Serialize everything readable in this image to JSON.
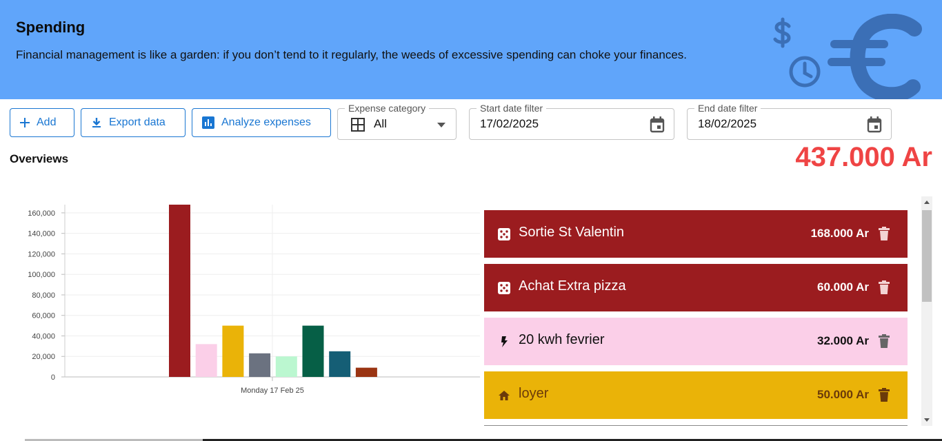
{
  "header": {
    "title": "Spending",
    "subtitle": "Financial management is like a garden: if you don’t tend to it regularly, the weeds of excessive spending can choke your finances.",
    "art_icons": [
      "dollar-icon",
      "clock-icon",
      "euro-icon"
    ]
  },
  "toolbar": {
    "add_label": "Add",
    "export_label": "Export data",
    "analyze_label": "Analyze expenses"
  },
  "filters": {
    "category": {
      "label": "Expense category",
      "value": "All"
    },
    "start_date": {
      "label": "Start date filter",
      "value": "17/02/2025"
    },
    "end_date": {
      "label": "End date filter",
      "value": "18/02/2025"
    }
  },
  "overview": {
    "title": "Overviews",
    "total": "437.000 Ar"
  },
  "chart_data": {
    "type": "bar",
    "categories": [
      "Monday 17 Feb 25"
    ],
    "series": [
      {
        "values": [
          168000
        ],
        "color": "#9b1c1f"
      },
      {
        "values": [
          32000
        ],
        "color": "#fbcfe8"
      },
      {
        "values": [
          50000
        ],
        "color": "#eab308"
      },
      {
        "values": [
          23000
        ],
        "color": "#6b7280"
      },
      {
        "values": [
          20000
        ],
        "color": "#bbf7d0"
      },
      {
        "values": [
          50000
        ],
        "color": "#065f46"
      },
      {
        "values": [
          25000
        ],
        "color": "#155e75"
      },
      {
        "values": [
          9000
        ],
        "color": "#9a3412"
      }
    ],
    "yticks": [
      "0",
      "20,000",
      "40,000",
      "60,000",
      "80,000",
      "100,000",
      "120,000",
      "140,000",
      "160,000"
    ],
    "ylim": [
      0,
      168000
    ],
    "grid": true
  },
  "expenses": [
    {
      "title": "Sortie St Valentin",
      "amount": "168.000 Ar",
      "icon": "dice-icon",
      "bg": "#9b1c1f",
      "fg": "#ffffff",
      "icon_color": "#ffffff",
      "del_color": "#f3d3d3"
    },
    {
      "title": "Achat Extra pizza",
      "amount": "60.000 Ar",
      "icon": "dice-icon",
      "bg": "#9b1c1f",
      "fg": "#ffffff",
      "icon_color": "#ffffff",
      "del_color": "#f3d3d3"
    },
    {
      "title": "20 kwh fevrier",
      "amount": "32.000 Ar",
      "icon": "bolt-icon",
      "bg": "#fbcfe8",
      "fg": "#111111",
      "icon_color": "#111111",
      "del_color": "#666666"
    },
    {
      "title": "loyer",
      "amount": "50.000 Ar",
      "icon": "home-icon",
      "bg": "#eab308",
      "fg": "#6b3a0a",
      "icon_color": "#6b3a0a",
      "del_color": "#6b3a0a"
    }
  ]
}
